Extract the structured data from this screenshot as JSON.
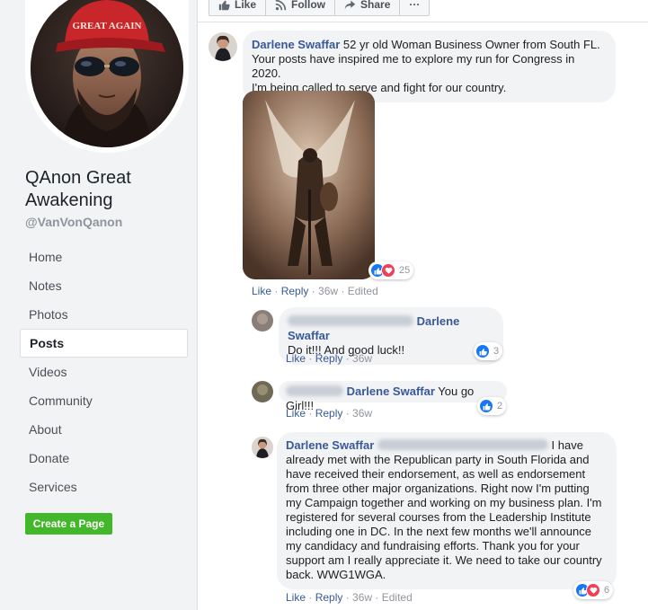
{
  "sidebar": {
    "page_name": "QAnon Great Awakening",
    "handle": "@VanVonQanon",
    "avatar_hat_text": "GREAT AGAIN",
    "nav": [
      "Home",
      "Notes",
      "Photos",
      "Posts",
      "Videos",
      "Community",
      "About",
      "Donate",
      "Services"
    ],
    "active_nav": "Posts",
    "create_page_label": "Create a Page"
  },
  "action_bar": {
    "like_label": "Like",
    "follow_label": "Follow",
    "share_label": "Share",
    "more_label": "···"
  },
  "comments": [
    {
      "author": "Darlene Swaffar",
      "text_lines": [
        "52 yr old Woman Business Owner from South FL.",
        "Your posts have inspired me to explore my run for Congress in 2020.",
        "I'm being called to serve and fight for our country."
      ],
      "reaction_count": "25",
      "actions": {
        "like": "Like",
        "reply": "Reply",
        "time": "36w",
        "edited": "Edited"
      }
    },
    {
      "mention": "Darlene Swaffar",
      "text": "Do it!!! And good luck!!",
      "reaction_count": "3",
      "actions": {
        "like": "Like",
        "reply": "Reply",
        "time": "36w"
      }
    },
    {
      "mention": "Darlene Swaffar",
      "text": "You go Girl!!!",
      "reaction_count": "2",
      "actions": {
        "like": "Like",
        "reply": "Reply",
        "time": "36w"
      }
    },
    {
      "author": "Darlene Swaffar",
      "text_lines": [
        "I have",
        "already met with the Republican party in South Florida and",
        "have received their endorsement, as well as endorsement",
        "from three other major organizations. Right now I'm putting",
        "my Campaign together and working on my business plan. I'm",
        "registered for several courses from the Leadership Institute",
        "including one in DC. In the next few months we'll announce",
        "my candidacy and fundraising efforts. Thank you for your",
        "support am I really appreciate it. We need to take our country",
        "back. WWG1WGA."
      ],
      "reaction_count": "6",
      "actions": {
        "like": "Like",
        "reply": "Reply",
        "time": "36w",
        "edited": "Edited"
      }
    }
  ],
  "colors": {
    "link": "#385898",
    "green": "#42b72a",
    "like": "#1877f2",
    "love": "#f33e58"
  }
}
